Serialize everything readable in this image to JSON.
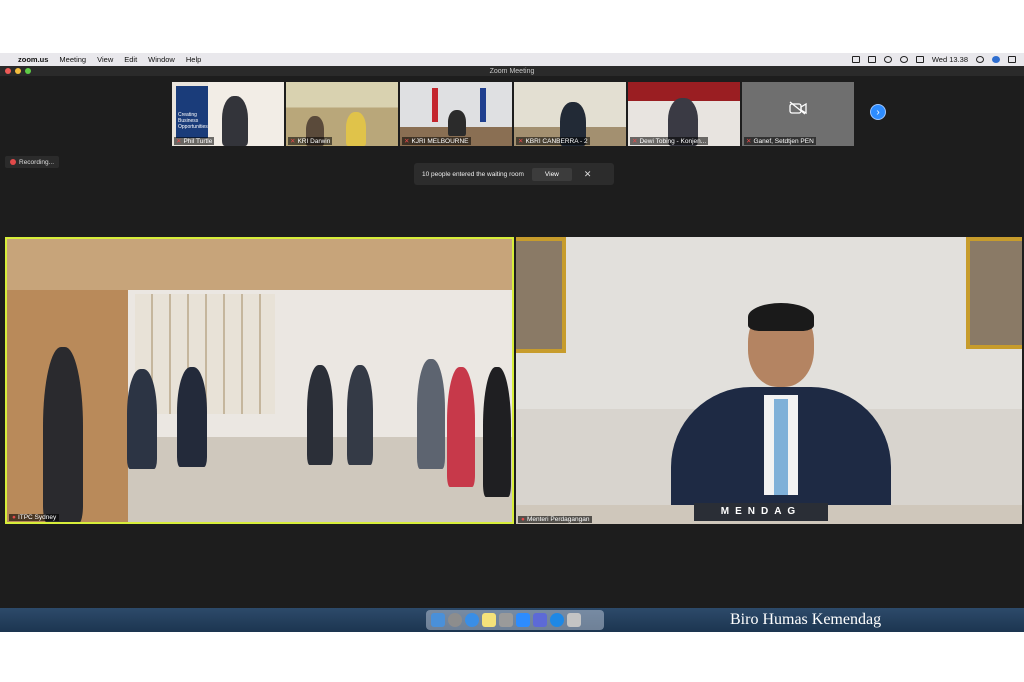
{
  "menubar": {
    "apple_icon": "apple-icon",
    "items": [
      "zoom.us",
      "Meeting",
      "View",
      "Edit",
      "Window",
      "Help"
    ],
    "clock": "Wed 13.38"
  },
  "window": {
    "title": "Zoom Meeting"
  },
  "thumbnails": [
    {
      "name": "Phil Turtle"
    },
    {
      "name": "KRI Darwin"
    },
    {
      "name": "KJRI MELBOURNE"
    },
    {
      "name": "KBRI CANBERRA - 2"
    },
    {
      "name": "Dewi Tobing - Konjen..."
    },
    {
      "name": "Ganef, Setdtjen PEN"
    }
  ],
  "thumbnail_slide_text": "Creating Business Opportunities",
  "recording": {
    "label": "Recording..."
  },
  "waiting_room": {
    "message": "10 people entered the waiting room",
    "view_label": "View"
  },
  "videos": {
    "left": {
      "name": "ITPC Sydney"
    },
    "right": {
      "name": "Menteri Perdagangan",
      "nameplate": "MENDAG"
    }
  },
  "caption": "Biro Humas Kemendag",
  "colors": {
    "active_speaker_border": "#d7ee3a",
    "zoom_blue": "#2d8cff",
    "recording_red": "#e24a4a"
  }
}
